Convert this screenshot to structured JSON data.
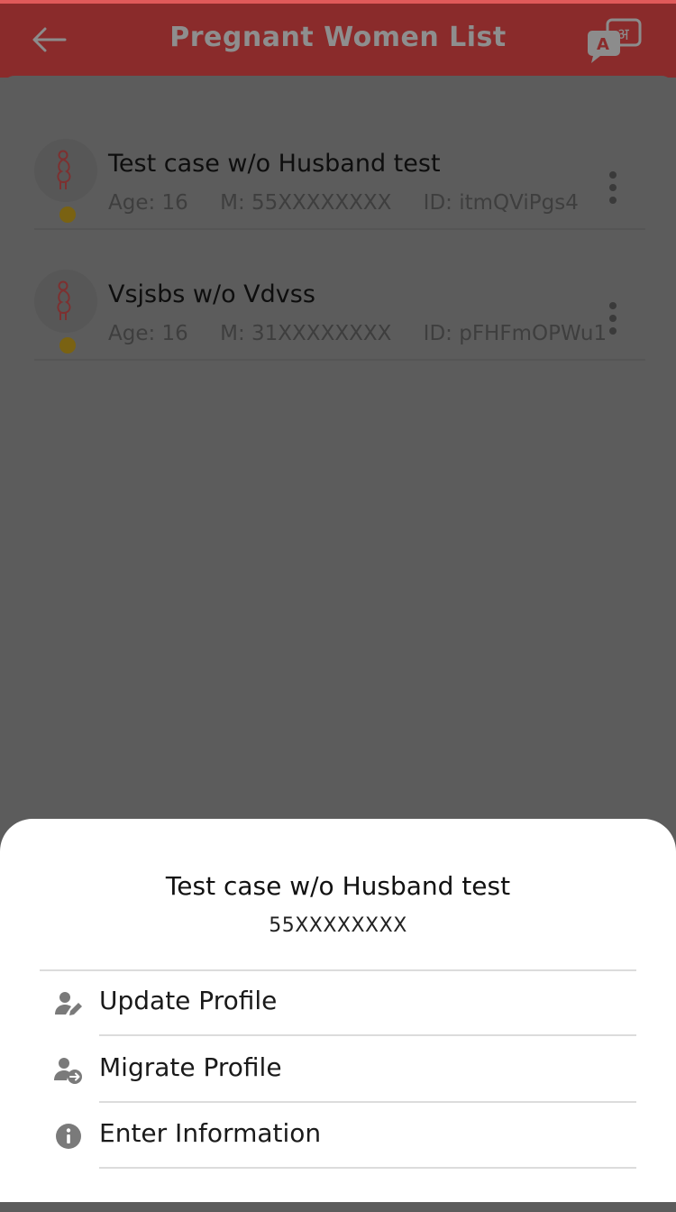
{
  "appbar": {
    "title": "Pregnant Women List",
    "lang_icon": "language-translate-icon"
  },
  "patients": [
    {
      "name": "Test case w/o Husband test",
      "age": "Age: 16",
      "mobile": "M: 55XXXXXXXX",
      "id": "ID: itmQViPgs4",
      "status_color": "#7a6212"
    },
    {
      "name": "Vsjsbs w/o Vdvss",
      "age": "Age: 16",
      "mobile": "M: 31XXXXXXXX",
      "id": "ID: pFHFmOPWu1",
      "status_color": "#7a6212"
    }
  ],
  "sheet": {
    "name": "Test case w/o Husband test",
    "phone": "55XXXXXXXX",
    "options": [
      {
        "label": "Update Profile",
        "icon": "user-edit-icon"
      },
      {
        "label": "Migrate Profile",
        "icon": "user-migrate-icon"
      },
      {
        "label": "Enter Information",
        "icon": "info-icon"
      }
    ]
  },
  "colors": {
    "appbar": "#8a2b2b",
    "overlay": "#5c5c5c",
    "sheet": "#ffffff",
    "status_dot": "#7a6212"
  }
}
